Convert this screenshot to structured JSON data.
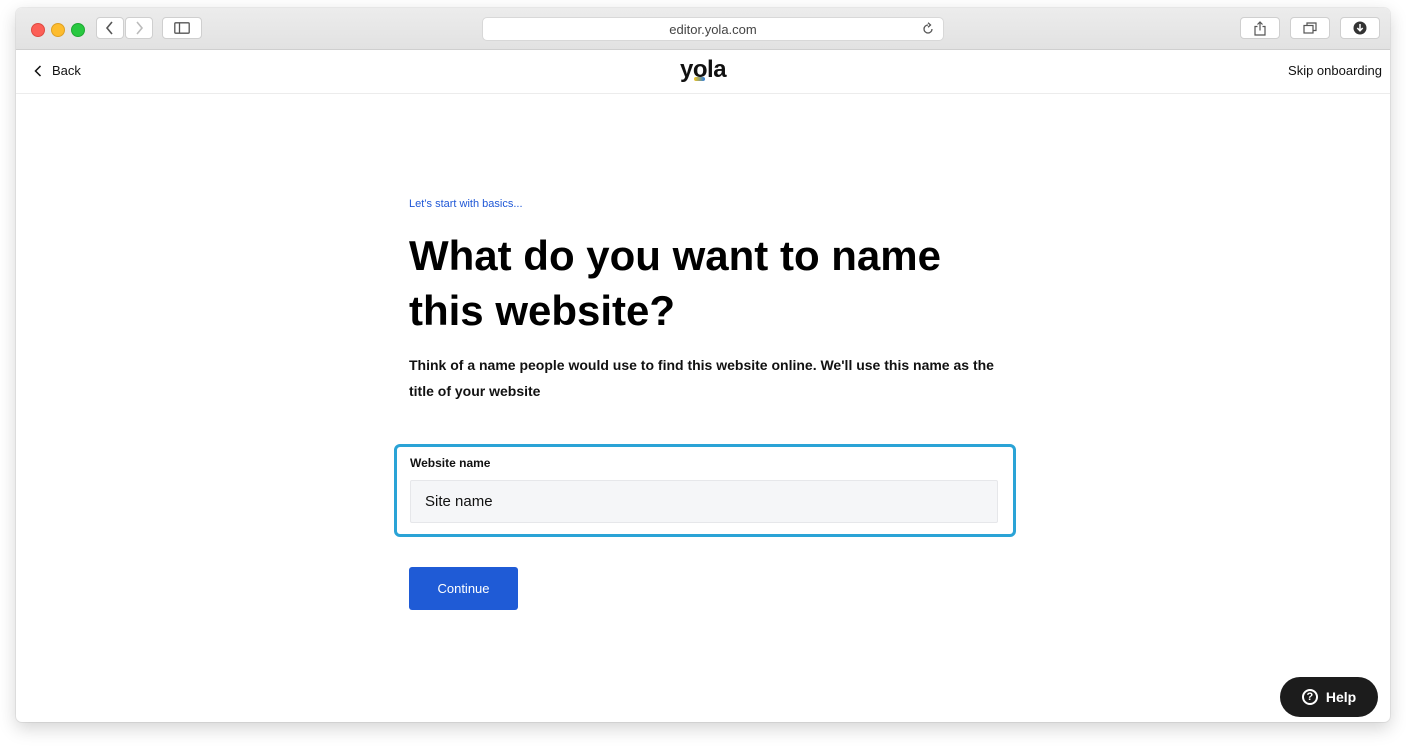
{
  "browser": {
    "url": "editor.yola.com",
    "icons": [
      "back-icon",
      "forward-icon",
      "sidebar-icon",
      "reload-icon",
      "share-icon",
      "tabs-icon",
      "download-icon"
    ]
  },
  "header": {
    "back_label": "Back",
    "logo_text_pre": "y",
    "logo_text_o": "o",
    "logo_text_post": "la",
    "skip_label": "Skip onboarding"
  },
  "main": {
    "eyebrow": "Let’s start with basics...",
    "headline": "What do you want to name this website?",
    "description": "Think of a name people would use to find this website online. We'll use this name as the title of your website",
    "field_label": "Website name",
    "field_placeholder": "Site name",
    "continue_label": "Continue"
  },
  "help": {
    "label": "Help",
    "icon_glyph": "?"
  },
  "colors": {
    "accent": "#1f5bd6",
    "focus_ring": "#2aa3d6",
    "help_bg": "#1c1c1c"
  }
}
